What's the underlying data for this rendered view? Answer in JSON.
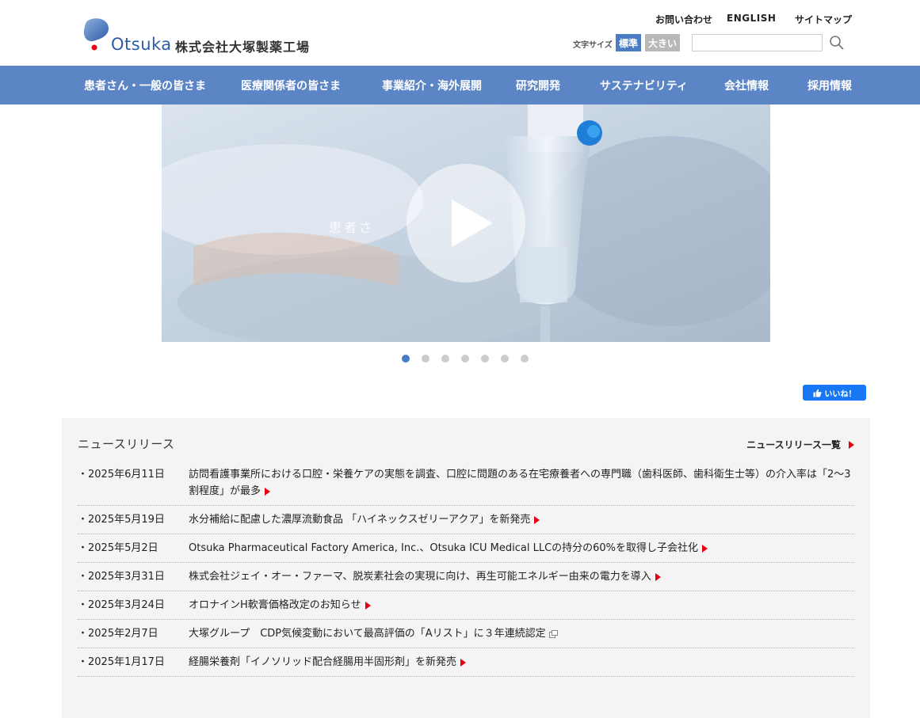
{
  "header": {
    "logo_word": "Otsuka",
    "company_name": "株式会社大塚製薬工場",
    "top_links": [
      "お問い合わせ",
      "ENGLISH",
      "サイトマップ"
    ],
    "font_size_label": "文字サイズ",
    "font_size_standard": "標準",
    "font_size_large": "大きい",
    "search_placeholder": ""
  },
  "nav": {
    "items": [
      "患者さん・一般の皆さま",
      "医療関係者の皆さま",
      "事業紹介・海外展開",
      "研究開発",
      "サステナビリティ",
      "会社情報",
      "採用情報"
    ]
  },
  "hero": {
    "caption": "患者さ",
    "slide_count": 7,
    "active_slide": 1
  },
  "social": {
    "fb_like_label": "いいね！"
  },
  "news": {
    "title": "ニュースリリース",
    "all_link": "ニュースリリース一覧",
    "items": [
      {
        "date": "・2025年6月11日",
        "text": "訪問看護事業所における口腔・栄養ケアの実態を調査、口腔に問題のある在宅療養者への専門職（歯科医師、歯科衛生士等）の介入率は「2〜3割程度」が最多",
        "icon": "red-arrow-icon"
      },
      {
        "date": "・2025年5月19日",
        "text": "水分補給に配慮した濃厚流動食品 「ハイネックスゼリーアクア」を新発売",
        "icon": "red-arrow-icon"
      },
      {
        "date": "・2025年5月2日",
        "text": "Otsuka Pharmaceutical Factory America, Inc.、Otsuka ICU Medical LLCの持分の60%を取得し子会社化",
        "icon": "red-arrow-icon"
      },
      {
        "date": "・2025年3月31日",
        "text": "株式会社ジェイ・オー・ファーマ、脱炭素社会の実現に向け、再生可能エネルギー由来の電力を導入",
        "icon": "red-arrow-icon"
      },
      {
        "date": "・2025年3月24日",
        "text": "オロナインH軟膏価格改定のお知らせ",
        "icon": "red-arrow-icon"
      },
      {
        "date": "・2025年2月7日",
        "text": "大塚グループ　CDP気候変動において最高評価の「Aリスト」に３年連続認定",
        "icon": "external-link-icon"
      },
      {
        "date": "・2025年1月17日",
        "text": "経腸栄養剤「イノソリッド配合経腸用半固形剤」を新発売",
        "icon": "red-arrow-icon"
      }
    ]
  },
  "colors": {
    "nav_bg": "#5c85c6",
    "accent_blue": "#4a7cc4",
    "arrow_red": "#e60012",
    "news_bg": "#f4f4f4"
  }
}
